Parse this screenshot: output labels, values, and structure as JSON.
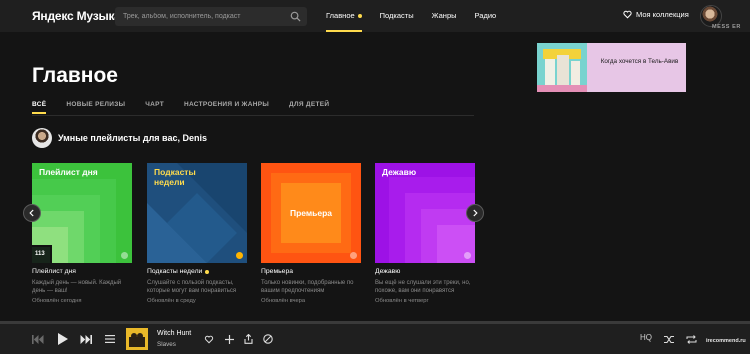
{
  "header": {
    "logo": "Яндекс Музыка",
    "search_placeholder": "Трек, альбом, исполнитель, подкаст",
    "nav": [
      {
        "label": "Главное",
        "active": true
      },
      {
        "label": "Подкасты"
      },
      {
        "label": "Жанры"
      },
      {
        "label": "Радио"
      }
    ],
    "collection_label": "Моя коллекция"
  },
  "main": {
    "title": "Главное",
    "tabs": [
      "ВСЁ",
      "НОВЫЕ РЕЛИЗЫ",
      "ЧАРТ",
      "НАСТРОЕНИЯ И ЖАНРЫ",
      "ДЛЯ ДЕТЕЙ"
    ],
    "active_tab": "ВСЁ",
    "section_title": "Умные плейлисты для вас, Denis",
    "cards": [
      {
        "cover_title": "Плейлист дня",
        "cover_badge": "113",
        "name": "Плейлист дня",
        "desc": "Каждый день — новый. Каждый день — ваш!",
        "date": "Обновлён сегодня",
        "color": "#3ec23e"
      },
      {
        "cover_title": "Подкасты недели",
        "name": "Подкасты недели",
        "desc": "Слушайте с пользой подкасты, которые могут вам понравиться",
        "date": "Обновлён в среду",
        "color": "#1d4e7a"
      },
      {
        "cover_title": "Премьера",
        "name": "Премьера",
        "desc": "Только новинки, подобранные по вашим предпочтениям",
        "date": "Обновлён вчера",
        "color": "#ff6a1a"
      },
      {
        "cover_title": "Дежавю",
        "name": "Дежавю",
        "desc": "Вы ещё не слушали эти треки, но, похоже, вам они понравятся",
        "date": "Обновлён в четверг",
        "color": "#a414e8"
      }
    ]
  },
  "ad": {
    "text": "Когда хочется в Тель-Авив"
  },
  "player": {
    "track_title": "Witch Hunt",
    "track_artist": "Slaves",
    "quality": "HQ"
  },
  "watermarks": {
    "top": "MESS ER",
    "bottom": "irecommend.ru"
  },
  "colors": {
    "accent": "#ffdb4d",
    "background": "#141414",
    "topbar": "#1f1f1f"
  }
}
